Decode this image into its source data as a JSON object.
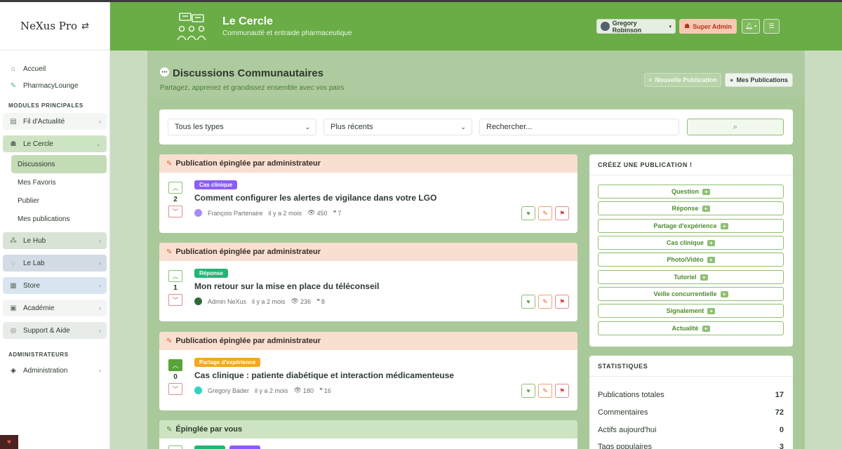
{
  "brand": {
    "name": "NeXus Pro",
    "logo_icon": "nexus-arrows-icon"
  },
  "sidebar": {
    "top_items": [
      {
        "label": "Accueil",
        "icon": "home-icon"
      },
      {
        "label": "PharmacyLounge",
        "icon": "pharmacy-lounge-icon"
      }
    ],
    "section_modules": "MODULES PRINCIPALES",
    "modules": {
      "fil": "Fil d'Actualité",
      "cercle": "Le Cercle",
      "hub": "Le Hub",
      "lab": "Le Lab",
      "store": "Store",
      "academie": "Académie",
      "support": "Support & Aide"
    },
    "cercle_sub": [
      "Discussions",
      "Mes Favoris",
      "Publier",
      "Mes publications"
    ],
    "section_admin": "ADMINISTRATEURS",
    "admin_item": "Administration"
  },
  "header": {
    "title": "Le Cercle",
    "subtitle": "Communauté et entraide pharmaceutique",
    "user_name": "Gregory Robinson",
    "role": "Super Admin",
    "bg_color": "#6aac46"
  },
  "page": {
    "title": "Discussions Communautaires",
    "subtitle": "Partagez, apprenez et grandissez ensemble avec vos pairs",
    "new_pub": "Nouvelle Publication",
    "my_pubs": "Mes Publications"
  },
  "filters": {
    "type_value": "Tous les types",
    "sort_value": "Plus récents",
    "search_placeholder": "Rechercher..."
  },
  "posts": [
    {
      "pinned_label": "Publication épinglée par administrateur",
      "tag": "Cas clinique",
      "tag_color": "#8b5cf6",
      "title": "Comment configurer les alertes de vigilance dans votre LGO",
      "author": "François Partenaire",
      "time": "il y a 2 mois",
      "views": "450",
      "comments": "7",
      "votes": "2",
      "avatar_color": "#a78bfa"
    },
    {
      "pinned_label": "Publication épinglée par administrateur",
      "tag": "Réponse",
      "tag_color": "#22b573",
      "title": "Mon retour sur la mise en place du téléconseil",
      "author": "Admin NeXus",
      "time": "il y a 2 mois",
      "views": "236",
      "comments": "8",
      "votes": "1",
      "avatar_color": "#2f6b3a"
    },
    {
      "pinned_label": "Publication épinglée par administrateur",
      "tag": "Partage d'expérience",
      "tag_color": "#f5a623",
      "title": "Cas clinique : patiente diabétique et interaction médicamenteuse",
      "author": "Gregory Bader",
      "time": "il y a 2 mois",
      "views": "180",
      "comments": "16",
      "votes": "0",
      "avatar_color": "#2dd4bf"
    }
  ],
  "post4": {
    "pinned_label": "Épinglée par vous"
  },
  "create": {
    "title": "CRÉEZ UNE PUBLICATION !",
    "types": [
      "Question",
      "Réponse",
      "Partage d'expérience",
      "Cas clinique",
      "Photo/Vidéo",
      "Tutoriel",
      "Veille concurrentielle",
      "Signalement",
      "Actualité"
    ]
  },
  "stats": {
    "title": "STATISTIQUES",
    "rows": [
      {
        "label": "Publications totales",
        "value": "17"
      },
      {
        "label": "Commentaires",
        "value": "72"
      },
      {
        "label": "Actifs aujourd'hui",
        "value": "0"
      },
      {
        "label": "Tags populaires",
        "value": "3"
      }
    ]
  }
}
